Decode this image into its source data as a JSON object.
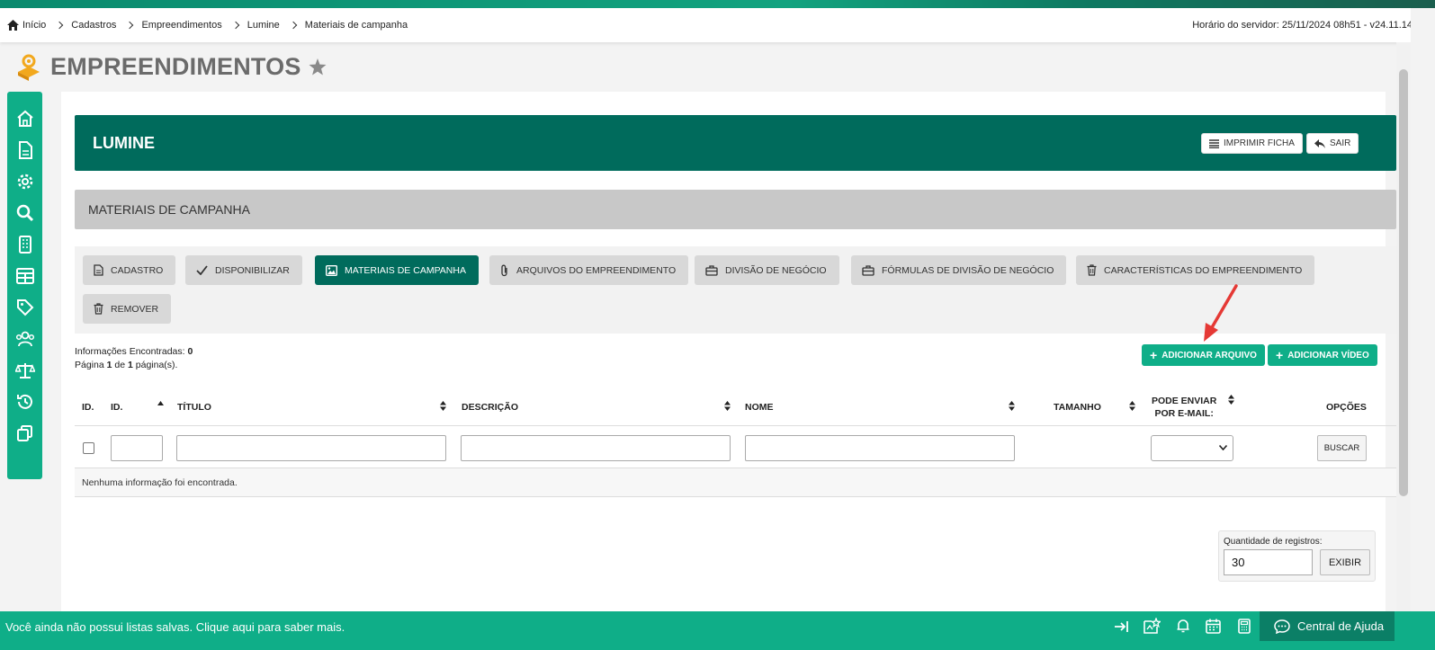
{
  "breadcrumb": [
    "Início",
    "Cadastros",
    "Empreendimentos",
    "Lumine",
    "Materiais de campanha"
  ],
  "server_time": "Horário do servidor: 25/11/2024 08h51 - v24.11.14",
  "page_title": "EMPREENDIMENTOS",
  "sidebar_icons": [
    "home-icon",
    "document-icon",
    "gear-icon",
    "search-icon",
    "building-icon",
    "table-icon",
    "tag-icon",
    "users-icon",
    "scale-icon",
    "history-icon",
    "copy-icon"
  ],
  "header": {
    "title": "LUMINE",
    "print_label": "IMPRIMIR FICHA",
    "exit_label": "SAIR"
  },
  "section_title": "MATERIAIS DE CAMPANHA",
  "tabs": [
    "CADASTRO",
    "DISPONIBILIZAR",
    "MATERIAIS DE CAMPANHA",
    "ARQUIVOS DO EMPREENDIMENTO",
    "DIVISÃO DE NEGÓCIO",
    "FÓRMULAS DE DIVISÃO DE NEGÓCIO",
    "CARACTERÍSTICAS DO EMPREENDIMENTO",
    "REMOVER"
  ],
  "active_tab": "MATERIAIS DE CAMPANHA",
  "info": {
    "found_label": "Informações Encontradas:",
    "found_count": "0",
    "page_prefix": "Página",
    "page_current": "1",
    "page_of": "de",
    "page_total": "1",
    "page_suffix": "página(s)."
  },
  "actions": {
    "add_file": "ADICIONAR ARQUIVO",
    "add_video": "ADICIONAR VÍDEO"
  },
  "table": {
    "headers": [
      "ID.",
      "ID.",
      "TÍTULO",
      "DESCRIÇÃO",
      "NOME",
      "TAMANHO",
      "PODE ENVIAR",
      "POR E-MAIL:",
      "OPÇÕES"
    ],
    "search_label": "BUSCAR",
    "empty_message": "Nenhuma informação foi encontrada."
  },
  "records": {
    "label": "Quantidade de registros:",
    "value": "30",
    "button": "EXIBIR"
  },
  "footer": {
    "message": "Você ainda não possui listas salvas. Clique aqui para saber mais.",
    "help_label": "Central de Ajuda"
  },
  "colors": {
    "primary": "#006b5c",
    "accent": "#0fae88",
    "section": "#c8c8c8",
    "arrow": "#e53935"
  }
}
